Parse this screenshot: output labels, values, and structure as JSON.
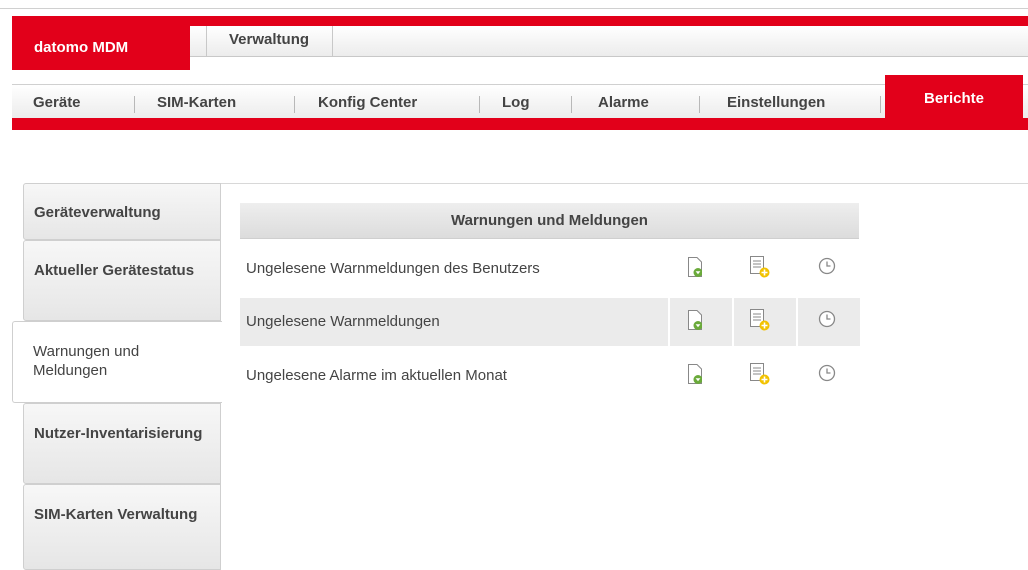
{
  "app": {
    "title": "datomo MDM"
  },
  "top_tabs": [
    {
      "label": "Verwaltung"
    }
  ],
  "nav": {
    "items": [
      {
        "label": "Geräte"
      },
      {
        "label": "SIM-Karten"
      },
      {
        "label": "Konfig Center"
      },
      {
        "label": "Log"
      },
      {
        "label": "Alarme"
      },
      {
        "label": "Einstellungen"
      }
    ],
    "active": "Berichte"
  },
  "sidebar": {
    "items": [
      {
        "label": "Geräteverwaltung"
      },
      {
        "label": "Aktueller Gerätestatus"
      },
      {
        "label": "Warnungen und Meldungen"
      },
      {
        "label": "Nutzer-Inventarisierung"
      },
      {
        "label": "SIM-Karten Verwaltung"
      }
    ],
    "active_index": 2
  },
  "panel": {
    "title": "Warnungen und Meldungen",
    "rows": [
      {
        "label": "Ungelesene Warnmeldungen des Benutzers"
      },
      {
        "label": "Ungelesene Warnmeldungen"
      },
      {
        "label": "Ungelesene Alarme im aktuellen Monat"
      }
    ],
    "icons": [
      "download-report-icon",
      "add-report-icon",
      "schedule-clock-icon"
    ]
  },
  "colors": {
    "brand_red": "#e2001a",
    "icon_green": "#6aaa3a",
    "icon_yellow": "#f2c200"
  }
}
